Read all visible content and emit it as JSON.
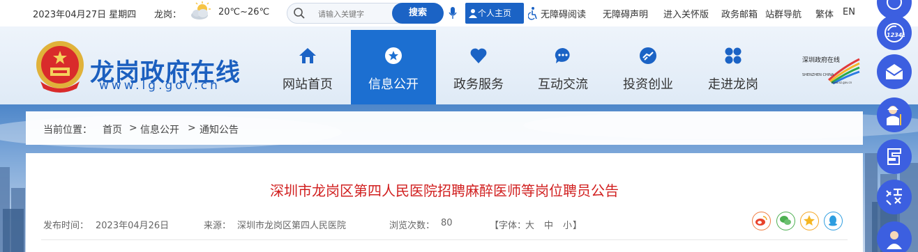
{
  "topbar": {
    "date": "2023年04月27日 星期四",
    "location_label": "龙岗：",
    "temperature": "20℃~26℃",
    "weather_icon": "partly-cloudy-icon",
    "search": {
      "placeholder": "请输入关键字",
      "button_label": "搜索"
    },
    "personal_label": "个人主页",
    "links": [
      "无障碍阅读",
      "无障碍声明",
      "进入关怀版",
      "政务邮箱",
      "站群导航",
      "繁体",
      "EN"
    ]
  },
  "header": {
    "site_title": "龙岗政府在线",
    "site_url": "www.lg.gov.cn",
    "nav": [
      {
        "label": "网站首页",
        "icon": "home-icon",
        "active": false
      },
      {
        "label": "信息公开",
        "icon": "star-icon",
        "active": true
      },
      {
        "label": "政务服务",
        "icon": "heart-icon",
        "active": false
      },
      {
        "label": "互动交流",
        "icon": "chat-icon",
        "active": false
      },
      {
        "label": "投资创业",
        "icon": "handshake-icon",
        "active": false
      },
      {
        "label": "走进龙岗",
        "icon": "grid-icon",
        "active": false
      }
    ],
    "sz_logo": {
      "brand": "深圳政府在线",
      "en": "SHENZHEN CHINA",
      "url": "www.sz.gov.cn"
    }
  },
  "breadcrumb": {
    "label": "当前位置：",
    "items": [
      "首页",
      "信息公开",
      "通知公告"
    ],
    "separator": ">"
  },
  "article": {
    "title": "深圳市龙岗区第四人民医院招聘麻醉医师等岗位聘员公告",
    "publish_label": "发布时间：",
    "publish_date": "2023年04月26日",
    "source_label": "来源：",
    "source": "深圳市龙岗区第四人民医院",
    "views_label": "浏览次数：",
    "views": "80",
    "font_label": "【字体：",
    "font_large": "大",
    "font_medium": "中",
    "font_small": "小",
    "font_close": "】",
    "share_icons": [
      "weibo-icon",
      "wechat-icon",
      "qzone-star-icon",
      "qq-icon"
    ]
  },
  "float_bar": {
    "buttons": [
      "12345-icon",
      "mail-icon",
      "elderly-icon",
      "write-icon",
      "search-zoom-icon",
      "profile-icon"
    ]
  },
  "colors": {
    "brand_blue": "#1b63c5",
    "nav_active": "#1c6fd1",
    "title_red": "#d11f1f",
    "float_blue": "#3c5fe0"
  }
}
